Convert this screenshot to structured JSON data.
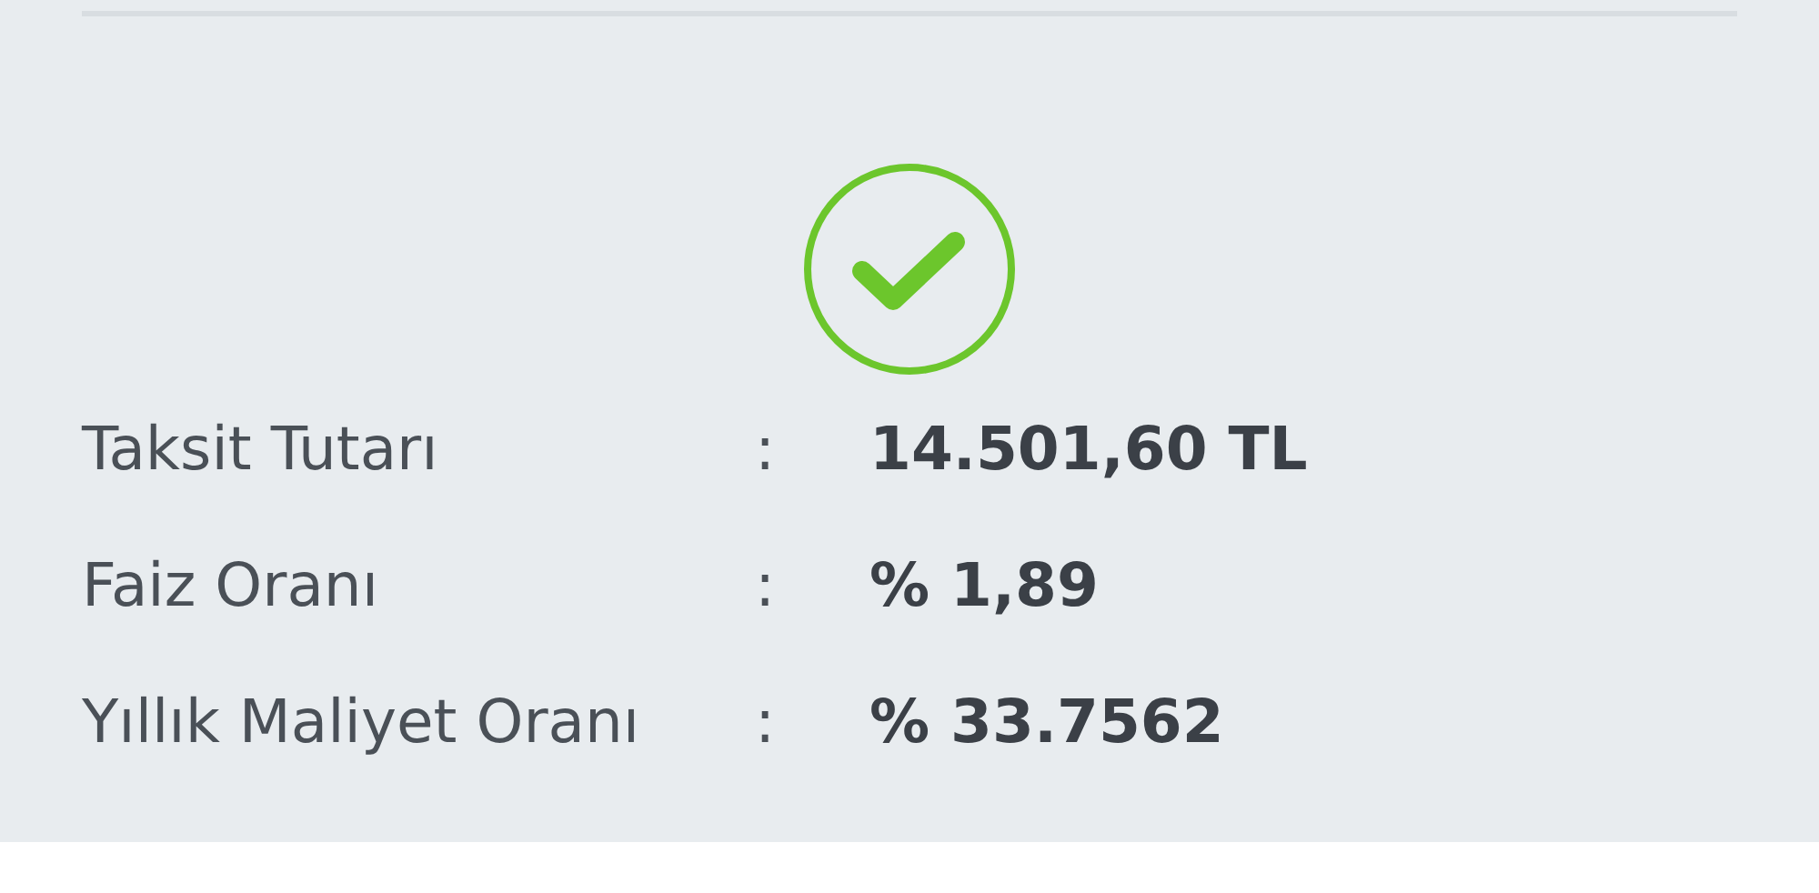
{
  "status": {
    "kind": "success"
  },
  "details": [
    {
      "label": "Taksit Tutarı",
      "separator": ":",
      "value": "14.501,60 TL"
    },
    {
      "label": "Faiz Oranı",
      "separator": ":",
      "value": "% 1,89"
    },
    {
      "label": "Yıllık Maliyet Oranı",
      "separator": ":",
      "value": "% 33.7562"
    }
  ]
}
